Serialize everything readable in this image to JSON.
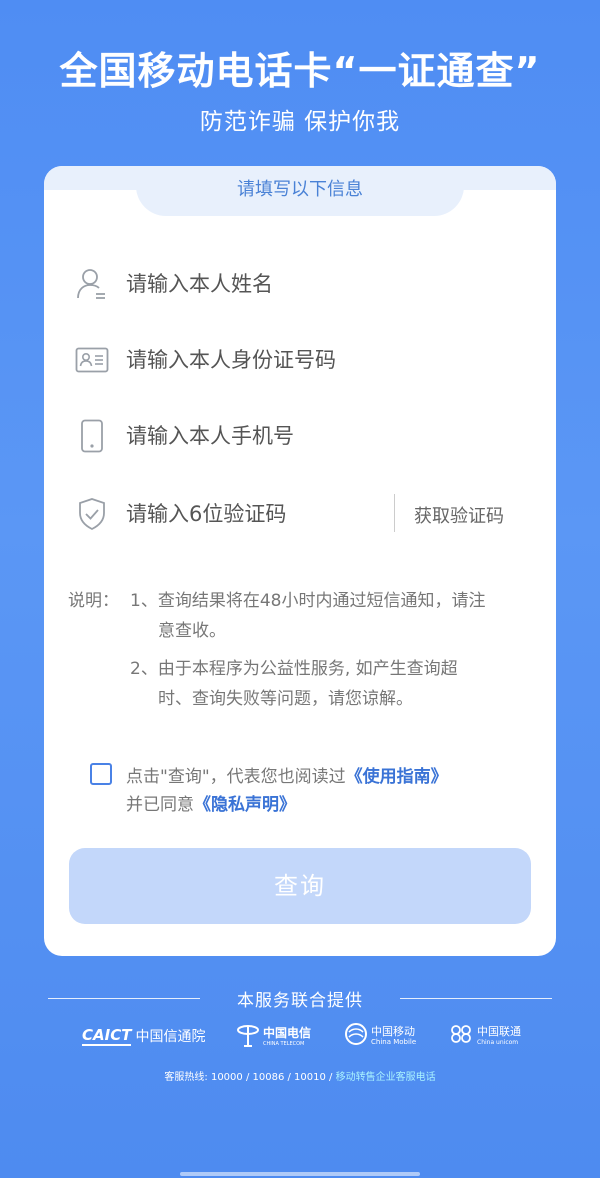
{
  "header": {
    "title": "全国移动电话卡“一证通查”",
    "subtitle": "防范诈骗 保护你我"
  },
  "form": {
    "section_title": "请填写以下信息",
    "name_placeholder": "请输入本人姓名",
    "id_placeholder": "请输入本人身份证号码",
    "phone_placeholder": "请输入本人手机号",
    "code_placeholder": "请输入6位验证码",
    "get_code_label": "获取验证码"
  },
  "notes": {
    "label": "说明：",
    "item1_line1": "1、查询结果将在48小时内通过短信通知，请注",
    "item1_line2": "意查收。",
    "item2_line1": "2、由于本程序为公益性服务, 如产生查询超",
    "item2_line2": "时、查询失败等问题，请您谅解。"
  },
  "agreement": {
    "text_part1": "点击\"查询\"，代表您也阅读过",
    "guide_link": "《使用指南》",
    "text_part2": "并已同意",
    "privacy_link": "《隐私声明》"
  },
  "query_button": "查询",
  "providers": {
    "title": "本服务联合提供",
    "caict_abbr": "CAICT",
    "caict_name": "中国信通院",
    "telecom_cn": "中国电信",
    "telecom_en": "CHINA TELECOM",
    "mobile_cn": "中国移动",
    "mobile_en": "China Mobile",
    "unicom_cn": "中国联通",
    "unicom_en": "China unicom"
  },
  "hotline": {
    "label": "客服热线: 10000 / 10086 / 10010 / ",
    "link": "移动转售企业客服电话"
  },
  "colors": {
    "background": "#4f8df3",
    "accent": "#4a82d6",
    "button_disabled": "#c3d7fa"
  }
}
